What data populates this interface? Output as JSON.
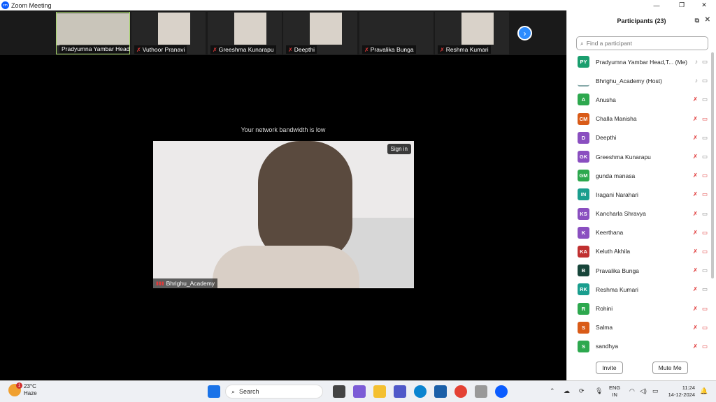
{
  "window": {
    "title": "Zoom Meeting",
    "app_icon": "zoom-icon"
  },
  "gallery": {
    "tiles": [
      {
        "name": "Pradyumna Yambar Head,...",
        "muted": false
      },
      {
        "name": "Vuthoor Pranavi",
        "muted": true
      },
      {
        "name": "Greeshma Kunarapu",
        "muted": true
      },
      {
        "name": "Deepthi",
        "muted": true
      },
      {
        "name": "Pravalika Bunga",
        "muted": true
      },
      {
        "name": "Reshma Kumari",
        "muted": true
      }
    ],
    "next_icon": "chevron-right-icon"
  },
  "main": {
    "notice": "Your network bandwidth is low",
    "signin_label": "Sign in",
    "speaker_name": "Bhrighu_Academy"
  },
  "participants": {
    "title": "Participants (23)",
    "search_placeholder": "Find a participant",
    "list": [
      {
        "initials": "PY",
        "name": "Pradyumna Yambar Head,T... (Me)",
        "color": "#1a9e6e",
        "mic_muted": false,
        "cam_off": false
      },
      {
        "initials": "",
        "name": "Bhrighu_Academy (Host)",
        "color": "#ffffff",
        "mic_muted": false,
        "cam_off": false
      },
      {
        "initials": "A",
        "name": "Anusha",
        "color": "#2da84e",
        "mic_muted": true,
        "cam_off": false
      },
      {
        "initials": "CM",
        "name": "Challa Manisha",
        "color": "#d95b18",
        "mic_muted": true,
        "cam_off": true
      },
      {
        "initials": "D",
        "name": "Deepthi",
        "color": "#8a4fc0",
        "mic_muted": true,
        "cam_off": false
      },
      {
        "initials": "GK",
        "name": "Greeshma Kunarapu",
        "color": "#8a4fc0",
        "mic_muted": true,
        "cam_off": false
      },
      {
        "initials": "GM",
        "name": "gunda manasa",
        "color": "#2da84e",
        "mic_muted": true,
        "cam_off": true
      },
      {
        "initials": "IN",
        "name": "Iragani Narahari",
        "color": "#1a9e8e",
        "mic_muted": true,
        "cam_off": true
      },
      {
        "initials": "KS",
        "name": "Kancharla Shravya",
        "color": "#8a4fc0",
        "mic_muted": true,
        "cam_off": false
      },
      {
        "initials": "K",
        "name": "Keerthana",
        "color": "#8a4fc0",
        "mic_muted": true,
        "cam_off": true
      },
      {
        "initials": "KA",
        "name": "Keluth Akhila",
        "color": "#c03030",
        "mic_muted": true,
        "cam_off": true
      },
      {
        "initials": "B",
        "name": "Pravalika Bunga",
        "color": "#17453a",
        "mic_muted": true,
        "cam_off": false
      },
      {
        "initials": "RK",
        "name": "Reshma Kumari",
        "color": "#1a9e8e",
        "mic_muted": true,
        "cam_off": false
      },
      {
        "initials": "R",
        "name": "Rohini",
        "color": "#2da84e",
        "mic_muted": true,
        "cam_off": true
      },
      {
        "initials": "S",
        "name": "Salma",
        "color": "#d95b18",
        "mic_muted": true,
        "cam_off": true
      },
      {
        "initials": "S",
        "name": "sandhya",
        "color": "#2da84e",
        "mic_muted": true,
        "cam_off": true
      }
    ],
    "invite_label": "Invite",
    "mute_me_label": "Mute Me"
  },
  "taskbar": {
    "weather_temp": "23°C",
    "weather_desc": "Haze",
    "notification_count": "1",
    "search_label": "Search",
    "lang_line1": "ENG",
    "lang_line2": "IN",
    "time": "11:24",
    "date": "14-12-2024"
  }
}
